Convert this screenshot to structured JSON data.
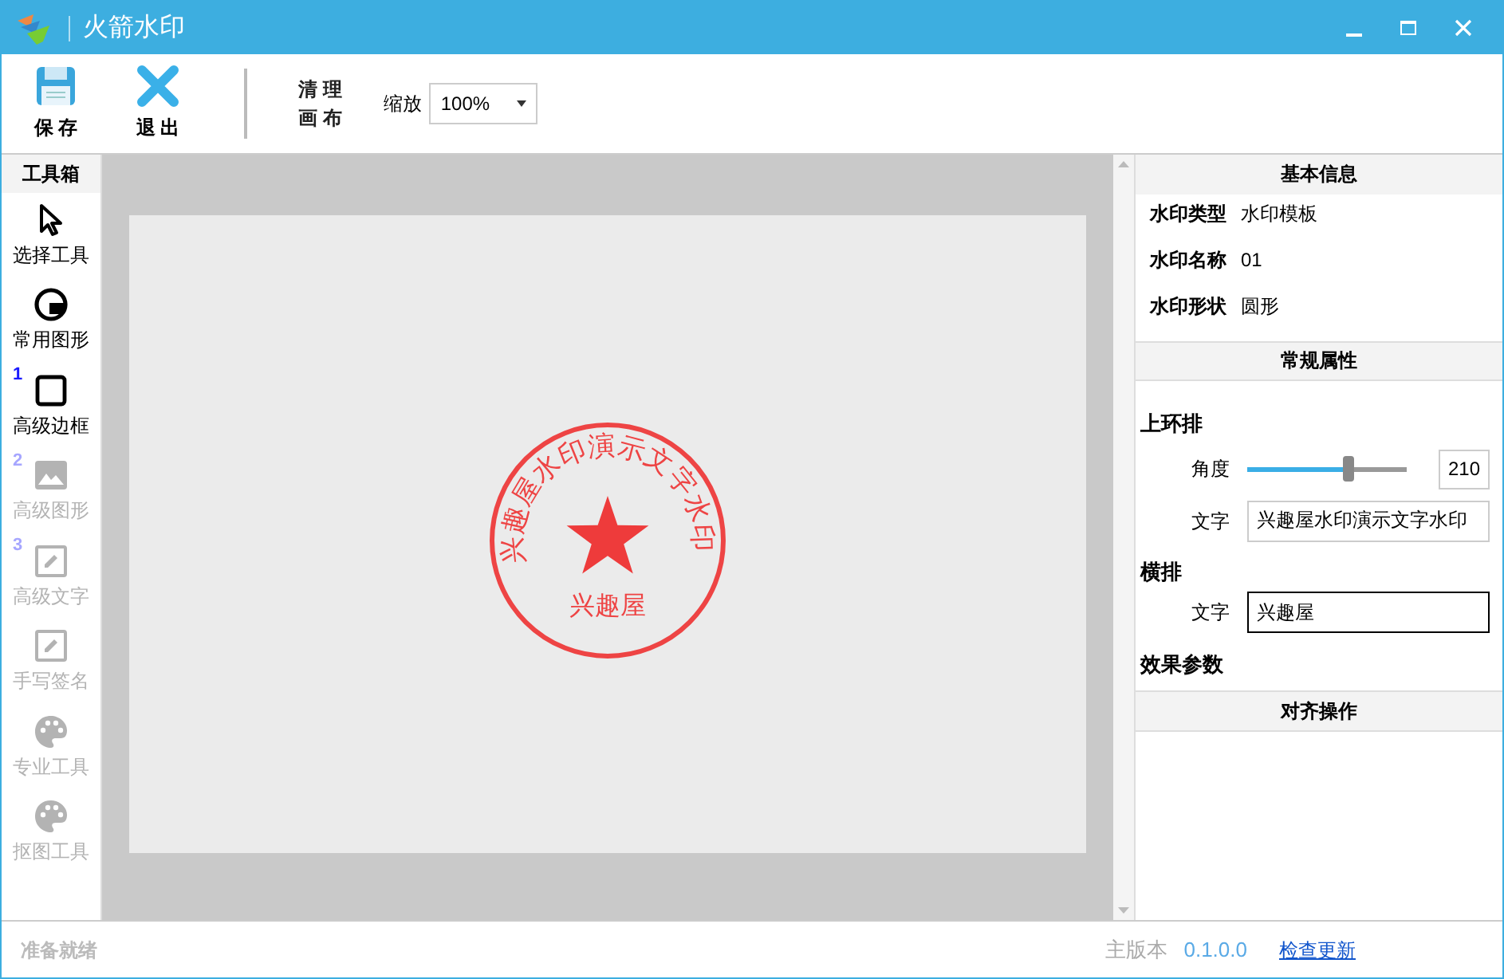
{
  "window": {
    "title": "火箭水印"
  },
  "toolbar": {
    "buttons": [
      {
        "kind": "save",
        "label": "保 存"
      },
      {
        "kind": "exit",
        "label": "退 出"
      }
    ],
    "clear": {
      "line1": "清 理",
      "line2": "画 布"
    },
    "zoom": {
      "label": "缩放",
      "value": "100%"
    }
  },
  "toolbox": {
    "title": "工具箱",
    "items": [
      {
        "kind": "pointer",
        "label": "选择工具",
        "enabled": true
      },
      {
        "kind": "shape",
        "label": "常用图形",
        "enabled": true
      },
      {
        "kind": "frame",
        "label": "高级边框",
        "badge": "1",
        "enabled": true
      },
      {
        "kind": "image",
        "label": "高级图形",
        "badge": "2",
        "enabled": false
      },
      {
        "kind": "edit",
        "label": "高级文字",
        "badge": "3",
        "enabled": false
      },
      {
        "kind": "edit",
        "label": "手写签名",
        "enabled": false
      },
      {
        "kind": "palette",
        "label": "专业工具",
        "enabled": false
      },
      {
        "kind": "palette",
        "label": "抠图工具",
        "enabled": false
      }
    ]
  },
  "stamp": {
    "arc_text": "兴趣屋水印演示文字水印",
    "center_text": "兴趣屋"
  },
  "panel": {
    "basic": {
      "title": "基本信息",
      "rows": [
        {
          "label": "水印类型",
          "value": "水印模板"
        },
        {
          "label": "水印名称",
          "value": "01"
        },
        {
          "label": "水印形状",
          "value": "圆形"
        }
      ]
    },
    "general": {
      "title": "常规属性",
      "top_ring": {
        "title": "上环排",
        "angle_label": "角度",
        "level": 0.63,
        "angle_value": "210",
        "text_label": "文字",
        "text_value": "兴趣屋水印演示文字水印"
      },
      "horizontal": {
        "title": "横排",
        "text_label": "文字",
        "text_value": "兴趣屋"
      },
      "effects_title": "效果参数"
    },
    "align": {
      "title": "对齐操作"
    }
  },
  "status_bar": {
    "status": "准备就绪",
    "version_label": "主版本",
    "version": "0.1.0.0",
    "update_link": "检查更新"
  }
}
